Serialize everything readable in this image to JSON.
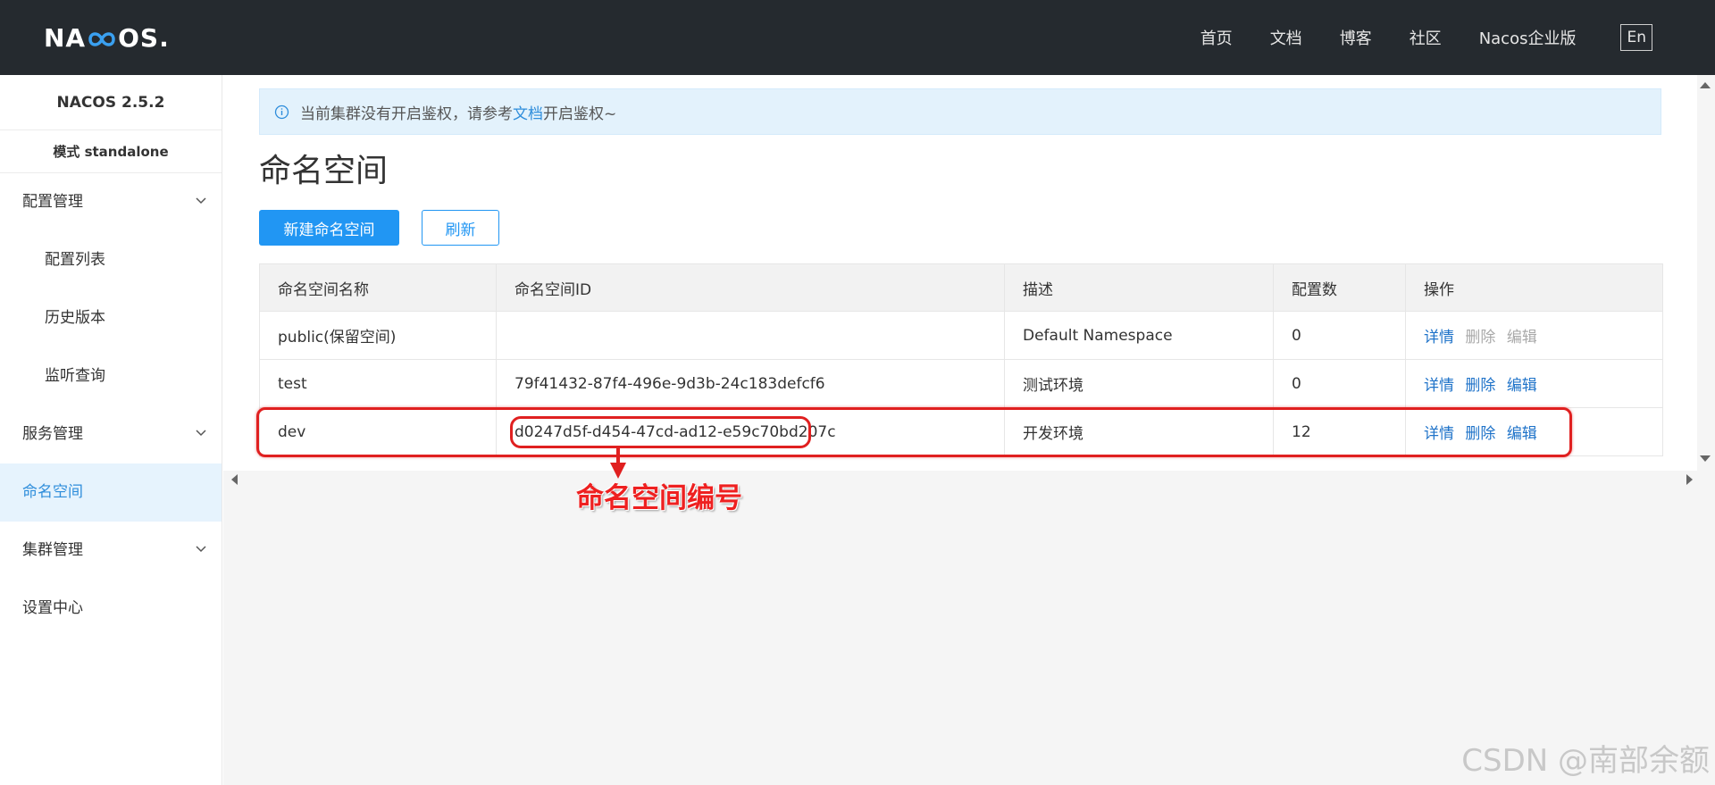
{
  "header": {
    "logo": "NACOS.",
    "nav": [
      "首页",
      "文档",
      "博客",
      "社区",
      "Nacos企业版"
    ],
    "lang_label": "En"
  },
  "sidebar": {
    "version": "NACOS 2.5.2",
    "mode": "模式 standalone",
    "items": [
      {
        "label": "配置管理",
        "expandable": true
      },
      {
        "label": "配置列表",
        "sub": true
      },
      {
        "label": "历史版本",
        "sub": true
      },
      {
        "label": "监听查询",
        "sub": true
      },
      {
        "label": "服务管理",
        "expandable": true
      },
      {
        "label": "命名空间",
        "active": true
      },
      {
        "label": "集群管理",
        "expandable": true
      },
      {
        "label": "设置中心"
      }
    ]
  },
  "notice": {
    "prefix": "当前集群没有开启鉴权，请参考",
    "link": "文档",
    "suffix": "开启鉴权~"
  },
  "page": {
    "title": "命名空间",
    "create_button": "新建命名空间",
    "refresh_button": "刷新"
  },
  "table": {
    "headers": [
      "命名空间名称",
      "命名空间ID",
      "描述",
      "配置数",
      "操作"
    ],
    "rows": [
      {
        "name": "public(保留空间)",
        "id": "",
        "desc": "Default Namespace",
        "count": "0",
        "ops": [
          "详情",
          "删除",
          "编辑"
        ],
        "ops_disabled": [
          false,
          true,
          true
        ]
      },
      {
        "name": "test",
        "id": "79f41432-87f4-496e-9d3b-24c183defcf6",
        "desc": "测试环境",
        "count": "0",
        "ops": [
          "详情",
          "删除",
          "编辑"
        ],
        "ops_disabled": [
          false,
          false,
          false
        ]
      },
      {
        "name": "dev",
        "id": "d0247d5f-d454-47cd-ad12-e59c70bd207c",
        "desc": "开发环境",
        "count": "12",
        "ops": [
          "详情",
          "删除",
          "编辑"
        ],
        "ops_disabled": [
          false,
          false,
          false
        ]
      }
    ]
  },
  "annotation": {
    "label": "命名空间编号"
  },
  "watermark": "CSDN @南部余额",
  "colors": {
    "header_bg": "#252a2f",
    "primary": "#2196f3",
    "link": "#1f73c9",
    "annotation": "#e02020"
  }
}
